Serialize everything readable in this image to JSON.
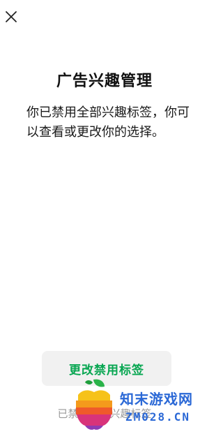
{
  "header": {
    "close_icon": "close-icon"
  },
  "main": {
    "title": "广告兴趣管理",
    "description": "你已禁用全部兴趣标签，你可以查看或更改你的选择。"
  },
  "actions": {
    "primary_label": "更改禁用标签",
    "footer_link_label": "已禁用全部兴趣标签"
  },
  "watermark": {
    "site_name_cn": "知末游戏网",
    "site_domain": "ZM028.CN"
  },
  "colors": {
    "accent": "#07a651",
    "button_bg": "#f1f1f1",
    "muted_text": "#9a9a9a",
    "watermark_blue": "#2a68d6"
  }
}
